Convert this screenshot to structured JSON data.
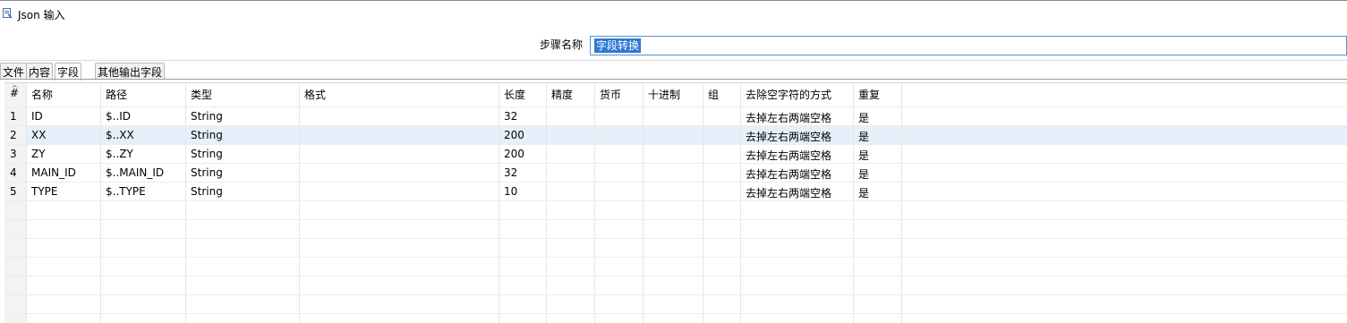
{
  "window": {
    "title": "Json 输入",
    "icon": "json-input-icon"
  },
  "step": {
    "label": "步骤名称",
    "value": "字段转换"
  },
  "tabs": [
    {
      "label": "文件",
      "active": false
    },
    {
      "label": "内容",
      "active": false
    },
    {
      "label": "字段",
      "active": true
    },
    {
      "label": "其他输出字段",
      "active": false
    }
  ],
  "table": {
    "columns": [
      "#",
      "名称",
      "路径",
      "类型",
      "格式",
      "长度",
      "精度",
      "货币",
      "十进制",
      "组",
      "去除空字符的方式",
      "重复"
    ],
    "rows": [
      [
        "1",
        "ID",
        "$..ID",
        "String",
        "",
        "32",
        "",
        "",
        "",
        "",
        "去掉左右两端空格",
        "是"
      ],
      [
        "2",
        "XX",
        "$..XX",
        "String",
        "",
        "200",
        "",
        "",
        "",
        "",
        "去掉左右两端空格",
        "是"
      ],
      [
        "3",
        "ZY",
        "$..ZY",
        "String",
        "",
        "200",
        "",
        "",
        "",
        "",
        "去掉左右两端空格",
        "是"
      ],
      [
        "4",
        "MAIN_ID",
        "$..MAIN_ID",
        "String",
        "",
        "32",
        "",
        "",
        "",
        "",
        "去掉左右两端空格",
        "是"
      ],
      [
        "5",
        "TYPE",
        "$..TYPE",
        "String",
        "",
        "10",
        "",
        "",
        "",
        "",
        "去掉左右两端空格",
        "是"
      ]
    ],
    "selected_row": 2
  }
}
